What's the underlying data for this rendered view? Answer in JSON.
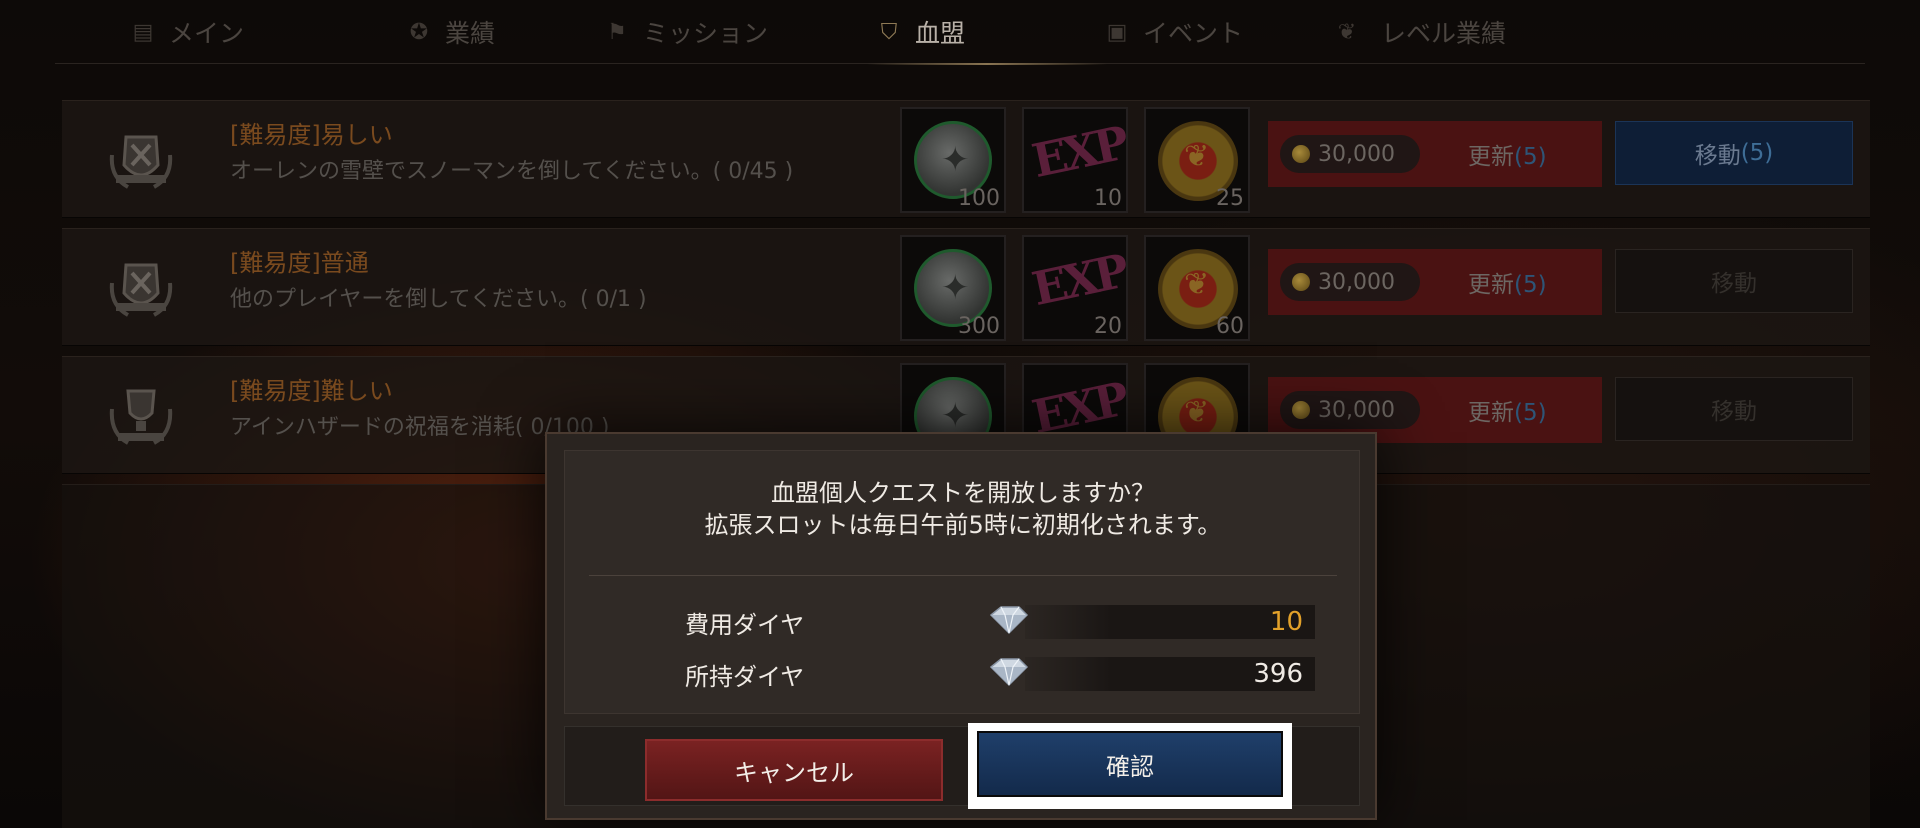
{
  "tabs": [
    {
      "label": "メイン",
      "icon": "list-icon",
      "active": false
    },
    {
      "label": "業績",
      "icon": "medal-icon",
      "active": false
    },
    {
      "label": "ミッション",
      "icon": "flag-icon",
      "active": false
    },
    {
      "label": "血盟",
      "icon": "shield-icon",
      "active": true
    },
    {
      "label": "イベント",
      "icon": "gift-icon",
      "active": false
    },
    {
      "label": "レベル業績",
      "icon": "wreath-icon",
      "active": false
    }
  ],
  "quests": [
    {
      "title": "[難易度]易しい",
      "description": "オーレンの雪壁でスノーマンを倒してください。( 0/45 )",
      "rewards": [
        "100",
        "10",
        "25"
      ],
      "cost": "30,000",
      "update_label": "更新",
      "update_count": "(5)",
      "move_label": "移動",
      "move_count": "(5)",
      "emblem": "crossed-swords-emblem-icon"
    },
    {
      "title": "[難易度]普通",
      "description": "他のプレイヤーを倒してください。( 0/1 )",
      "rewards": [
        "300",
        "20",
        "60"
      ],
      "cost": "30,000",
      "update_label": "更新",
      "update_count": "(5)",
      "move_label": "移動",
      "move_count": "",
      "emblem": "crossed-swords-emblem-icon"
    },
    {
      "title": "[難易度]難しい",
      "description": "アインハザードの祝福を消耗( 0/100 )",
      "rewards": [],
      "cost": "30,000",
      "update_label": "更新",
      "update_count": "(5)",
      "move_label": "移動",
      "move_count": "",
      "emblem": "trophy-emblem-icon"
    }
  ],
  "dialog": {
    "message_line1": "血盟個人クエストを開放しますか？",
    "message_line2": "拡張スロットは毎日午前5時に初期化されます。",
    "cost_label": "費用ダイヤ",
    "cost_value": "10",
    "owned_label": "所持ダイヤ",
    "owned_value": "396",
    "cancel_label": "キャンセル",
    "confirm_label": "確認"
  },
  "colors": {
    "accent_gold": "#e2a12a",
    "confirm_blue": "#1f3f6a",
    "cancel_red": "#7a2222"
  }
}
